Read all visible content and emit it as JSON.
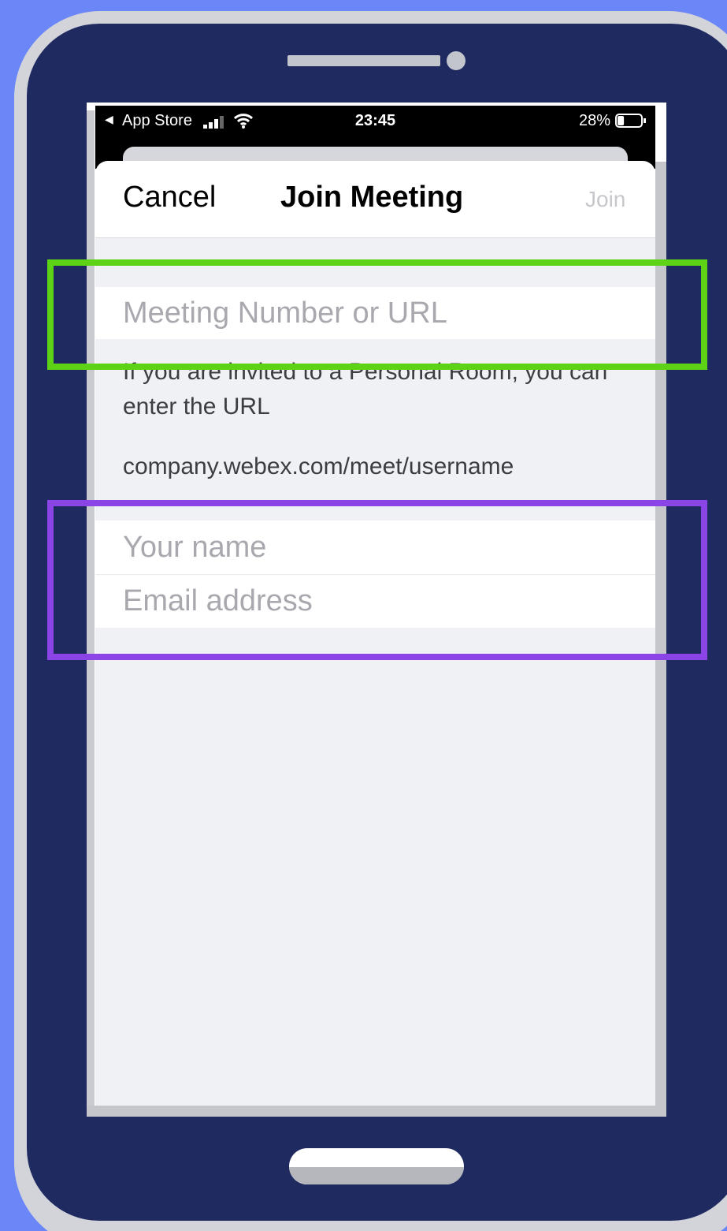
{
  "status_bar": {
    "back_arrow": "◀",
    "back_app": "App Store",
    "time": "23:45",
    "battery_percent": "28%",
    "battery_level": 0.28,
    "icons": [
      "signal-icon",
      "wifi-icon",
      "battery-icon"
    ]
  },
  "nav": {
    "cancel_label": "Cancel",
    "title": "Join Meeting",
    "join_label": "Join"
  },
  "form": {
    "meeting_number_placeholder": "Meeting Number or URL",
    "meeting_number_value": "",
    "hint": "If you are invited to a Personal Room, you can enter the URL",
    "url_example": "company.webex.com/meet/username",
    "name_placeholder": "Your name",
    "name_value": "",
    "email_placeholder": "Email address",
    "email_value": ""
  },
  "colors": {
    "background": "#6b86f7",
    "phone_body": "#1f2a60",
    "highlight_green": "#5ed316",
    "highlight_purple": "#8b44e6",
    "join_disabled": "#c7c7cc"
  }
}
